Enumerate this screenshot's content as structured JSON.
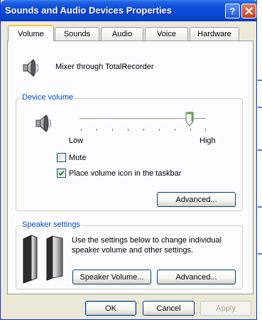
{
  "window": {
    "title": "Sounds and Audio Devices Properties"
  },
  "titlebar": {
    "help_label": "?",
    "close_label": "X"
  },
  "tabs": [
    {
      "label": "Volume",
      "active": true
    },
    {
      "label": "Sounds",
      "active": false
    },
    {
      "label": "Audio",
      "active": false
    },
    {
      "label": "Voice",
      "active": false
    },
    {
      "label": "Hardware",
      "active": false
    }
  ],
  "device": {
    "name": "Mixer through TotalRecorder",
    "icon": "speaker-icon"
  },
  "device_volume": {
    "group_label": "Device volume",
    "low_label": "Low",
    "high_label": "High",
    "level": 0.87,
    "mute_label": "Mute",
    "mute_checked": false,
    "taskbar_label": "Place volume icon in the taskbar",
    "taskbar_checked": true,
    "advanced_label": "Advanced..."
  },
  "speaker_settings": {
    "group_label": "Speaker settings",
    "description_line1": "Use the settings below to change individual",
    "description_line2": "speaker volume and other settings.",
    "speaker_volume_label": "Speaker Volume...",
    "advanced_label": "Advanced..."
  },
  "footer": {
    "ok_label": "OK",
    "cancel_label": "Cancel",
    "apply_label": "Apply"
  },
  "colors": {
    "title_bar": "#0A4CD9",
    "group_label": "#0046D5",
    "dialog_bg": "#ECE9D8",
    "tab_highlight": "#FFC83C"
  }
}
